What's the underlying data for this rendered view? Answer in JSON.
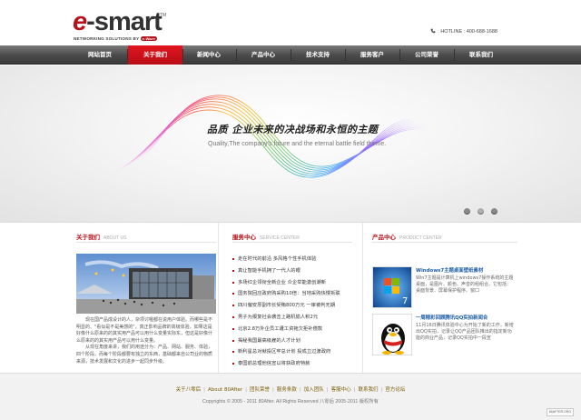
{
  "logo": {
    "brand_prefix": "e",
    "brand_rest": "smart",
    "trademark": "TM",
    "tagline": "NETWORKING SOLUTIONS BY",
    "badge": "e-Ware"
  },
  "header": {
    "hotline": "HOTLINE : 400-688-1688",
    "phone_icon": "phone-icon"
  },
  "nav": {
    "items": [
      {
        "label": "网站首页",
        "active": false
      },
      {
        "label": "关于我们",
        "active": true
      },
      {
        "label": "新闻中心",
        "active": false
      },
      {
        "label": "产品中心",
        "active": false
      },
      {
        "label": "技术支持",
        "active": false
      },
      {
        "label": "服务客户",
        "active": false
      },
      {
        "label": "公司荣誉",
        "active": false
      },
      {
        "label": "联系我们",
        "active": false
      }
    ],
    "active_color": "#d8121b"
  },
  "banner": {
    "slogan_cn": "品质 企业未来的决战场和永恒的主题",
    "slogan_en": "Quality,The company's future and the eternal battle field theme.",
    "slide_count": 3,
    "active_slide": 2
  },
  "about": {
    "title": "关于我们",
    "subtitle": "ABOUT US",
    "text": [
      "现在国产品成设计的人，杂项讨喔都在说用户体验。而哪些是不明显的、\"看似是不是美感的\"，真正影响品牌的高级体验，如果这是好像什么原来的的其实用产品可以用什么变量实际东，但这是好像什么原来的的其实用产品可以用什么变量。",
      "从现在角度来讲，我们的用途分为：产品、网站、服务、体验，四个阶段。而每个阶段都要有独立的东西，基础都来自公司业的物质来源，技术发展和文化的进步一起同步升级。"
    ]
  },
  "services": {
    "title": "服务中心",
    "subtitle": "SERVICE CENTER",
    "items": [
      "走在时代的前沿 多风格个性手机体验",
      "真让智能手机拥了一代人的眼",
      "多场红企领衔全新企业 众企举能激创潮新",
      "国务院回应政府购采购10倍：当地采购快慢拆联",
      "四川偏安厚副市长受贿800万元 一审被判无期",
      "男子为报复社会袭击上路机偷人积2元",
      "北京2.8万外企员工遭工资拖欠拒补偿款",
      "揭秘我国最高级雇的人才计划",
      "新利星总对就投区牢总计划 投成立过渡政府",
      "泰国前总理他信宣以将获政府特赦"
    ]
  },
  "products": {
    "title": "产品中心",
    "subtitle": "PRODUCT CENTER",
    "items": [
      {
        "title": "Windows7主题桌面壁纸素材",
        "desc": "Win7主题是计算机上windows7操作系统的主题桌面，是图片、颜色、声音的组组合。它包括：桌面背景、屏幕保护程序、窗口"
      },
      {
        "title": "一周精彩回顾腾讯QQ实拍新闻合",
        "desc": "11月16日腾讯体验中心为开始了新的工作，新增出QQ实拍，记录让QQ产品团队推出的指定新功能的商业产品，记录QQ实拍中一段宣"
      }
    ]
  },
  "footer": {
    "links": [
      "关于八零后",
      "About 80After",
      "团队荣誉",
      "服务条款",
      "加入团队",
      "客服中心",
      "联系我们",
      "官方论坛"
    ],
    "separator": "|",
    "copyright": "Copyrights © 2005 - 2011 80After. All Rights Reserved 八零后 2005-2011 版权所有",
    "badge": "80AFTER.ORG"
  }
}
